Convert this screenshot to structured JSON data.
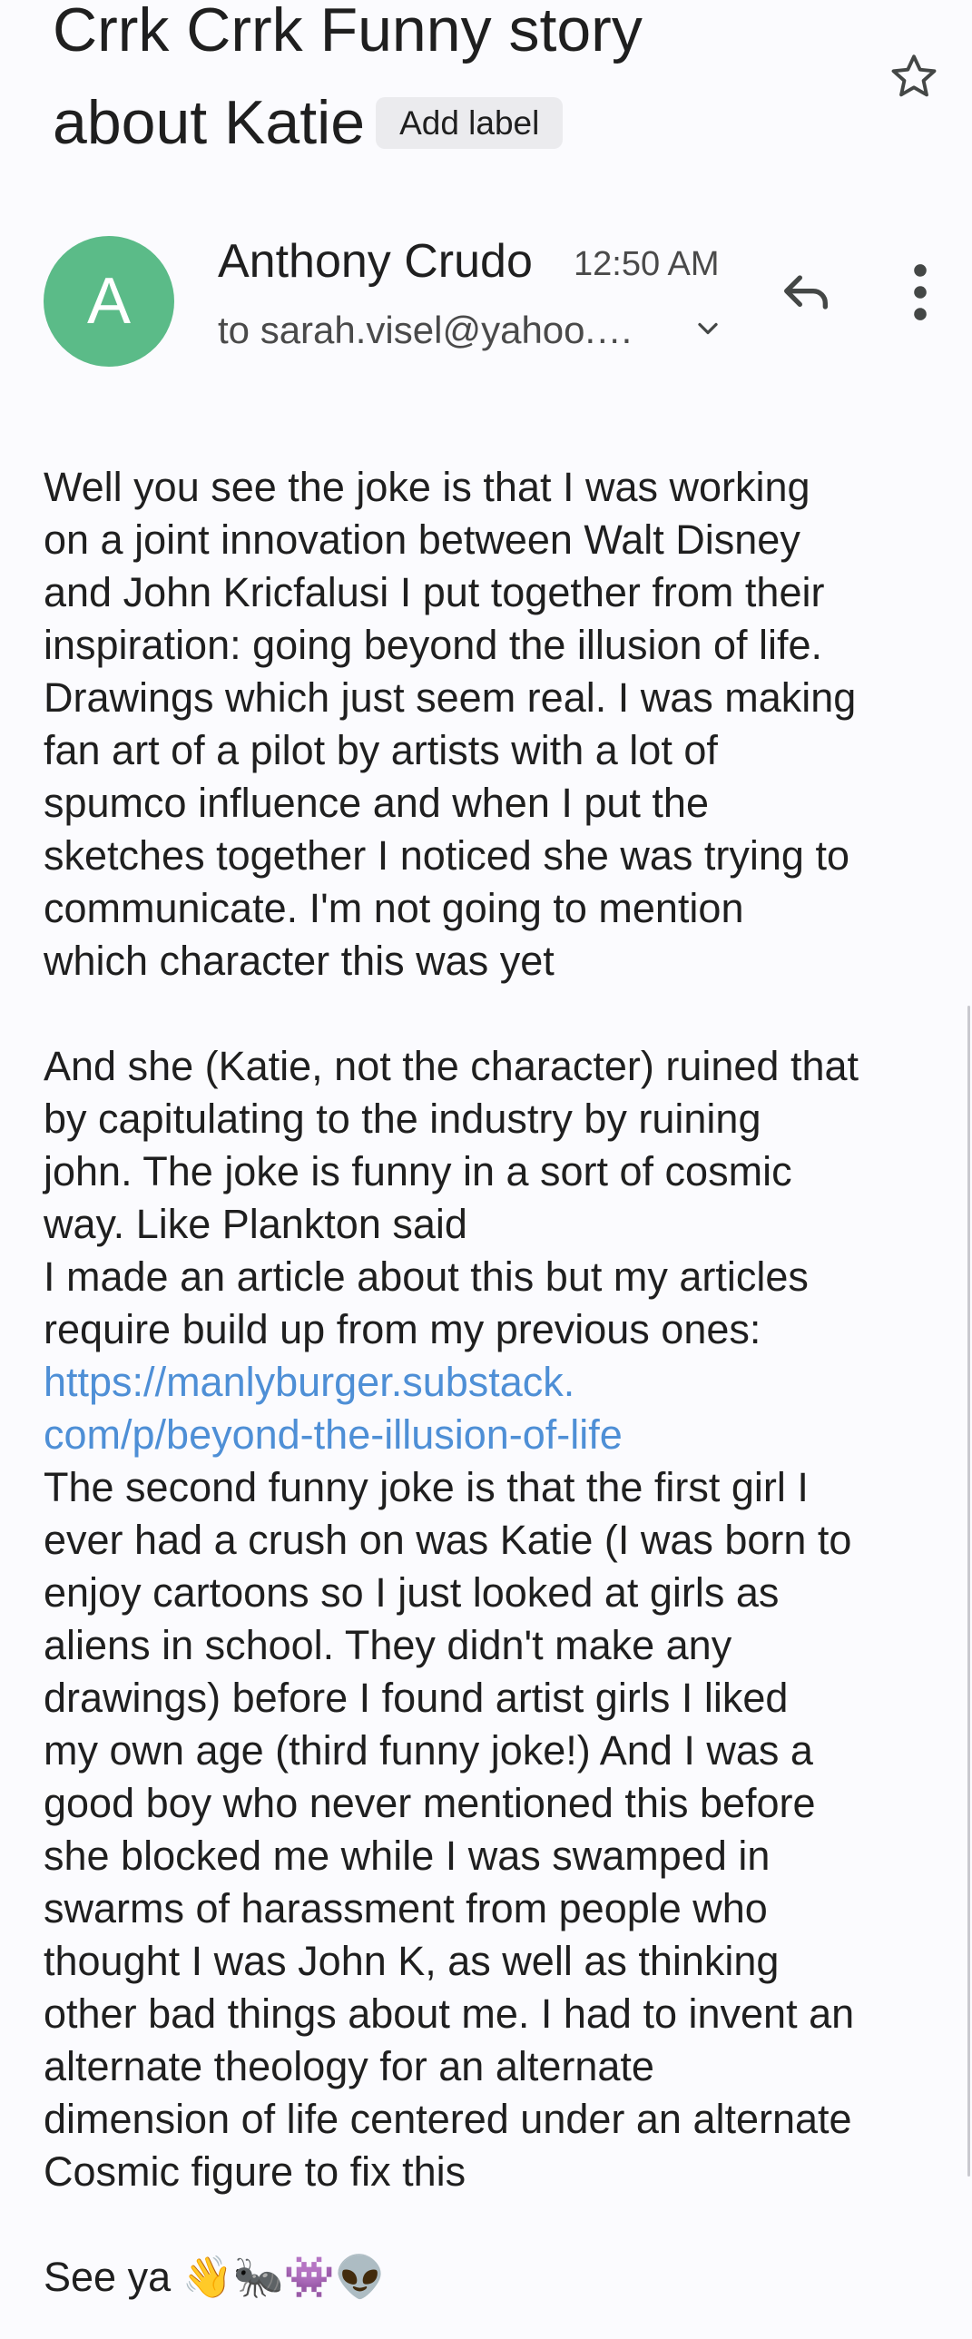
{
  "email": {
    "subject_line1": "Crrk Crrk Funny story",
    "subject_line2": "about Katie",
    "add_label": "Add label",
    "avatar_letter": "A",
    "sender_name": "Anthony Crudo",
    "time": "12:50 AM",
    "recipient": "to sarah.visel@yahoo.…",
    "body": {
      "p1": [
        "Well you see the joke is that I was working",
        "on a joint innovation between Walt Disney",
        "and John Kricfalusi I put together from their",
        "inspiration: going beyond the illusion of life.",
        "Drawings which just seem real. I was making",
        "fan art of a pilot by artists with a lot of",
        "spumco influence and when I put the",
        "sketches together I noticed she was trying to",
        "communicate. I'm not going to mention",
        "which character this was yet"
      ],
      "p2": [
        "And she (Katie, not the character) ruined that",
        "by capitulating to the industry by ruining",
        "john. The joke is funny in a sort of cosmic",
        "way. Like Plankton said",
        "I made an article about this but my articles",
        "require build up from my previous ones:"
      ],
      "link": [
        "https://manlyburger.substack.",
        "com/p/beyond-the-illusion-of-life"
      ],
      "p3": [
        "The second funny joke is that the first girl I",
        "ever had a crush on was Katie (I was born to",
        "enjoy cartoons so I just looked at girls as",
        "aliens in school. They didn't make any",
        "drawings) before I found artist girls I liked",
        "my own age (third funny joke!) And I was a",
        "good boy who never mentioned this before",
        "she blocked me while I was swamped in",
        "swarms of harassment from people who",
        "thought I was John K, as well as thinking",
        "other bad things about me. I had to invent an",
        "alternate theology for an alternate",
        "dimension of life centered under an alternate",
        "Cosmic figure to fix this"
      ],
      "signoff": "See ya 👋🐜👾👽"
    }
  },
  "icons": {
    "star": "star-icon",
    "chevron": "chevron-down-icon",
    "reply": "reply-icon",
    "more": "more-vert-icon"
  },
  "colors": {
    "avatar": "#5bbb88",
    "link": "#4e8fd6",
    "background": "#fbfbfe",
    "chip": "#ebebee"
  }
}
